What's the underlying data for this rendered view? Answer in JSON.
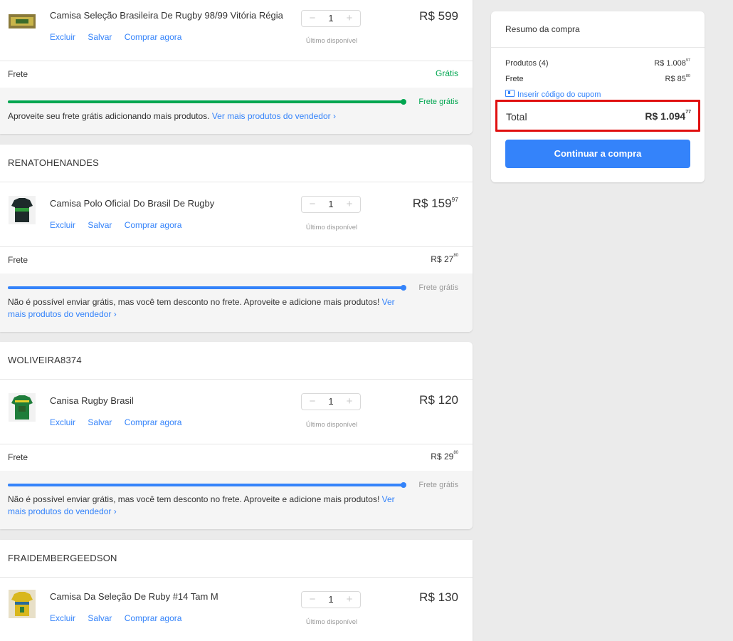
{
  "labels": {
    "excluir": "Excluir",
    "salvar": "Salvar",
    "comprar": "Comprar agora",
    "stock": "Último disponível",
    "frete": "Frete",
    "frete_gratis": "Frete grátis",
    "gratis": "Grátis",
    "minus": "−",
    "plus": "+"
  },
  "cards": [
    {
      "seller": "",
      "product": "Camisa Seleção Brasileira De Rugby 98/99 Vitória Régia",
      "quantity": "1",
      "price_int": "R$ 599",
      "price_cents": "",
      "shipping_price_int": "",
      "shipping_price_cents": "",
      "shipping_free_text": "Grátis",
      "progress": 1.0,
      "progress_color": "#00a650",
      "promo_text": "Aproveite seu frete grátis adicionando mais produtos.",
      "promo_link": "Ver mais produtos do vendedor ›"
    },
    {
      "seller": "RENATOHENANDES",
      "product": "Camisa Polo Oficial Do Brasil De Rugby",
      "quantity": "1",
      "price_int": "R$ 159",
      "price_cents": "97",
      "shipping_price_int": "R$ 27",
      "shipping_price_cents": "80",
      "progress": 1.0,
      "progress_color": "#3483fa",
      "promo_text": "Não é possível enviar grátis, mas você tem desconto no frete. Aproveite e adicione mais produtos!",
      "promo_link": "Ver mais produtos do vendedor ›"
    },
    {
      "seller": "WOLIVEIRA8374",
      "product": "Canisa Rugby Brasil",
      "quantity": "1",
      "price_int": "R$ 120",
      "price_cents": "",
      "shipping_price_int": "R$ 29",
      "shipping_price_cents": "80",
      "progress": 1.0,
      "progress_color": "#3483fa",
      "promo_text": "Não é possível enviar grátis, mas você tem desconto no frete. Aproveite e adicione mais produtos!",
      "promo_link": "Ver mais produtos do vendedor ›"
    },
    {
      "seller": "FRAIDEMBERGEEDSON",
      "product": "Camisa Da Seleção De Ruby #14 Tam M",
      "quantity": "1",
      "price_int": "R$ 130",
      "price_cents": ""
    }
  ],
  "summary": {
    "title": "Resumo da compra",
    "products_label": "Produtos (4)",
    "products_int": "R$ 1.008",
    "products_cents": "97",
    "shipping_label": "Frete",
    "shipping_int": "R$ 85",
    "shipping_cents": "80",
    "coupon_label": "Inserir código do cupom",
    "total_label": "Total",
    "total_int": "R$ 1.094",
    "total_cents": "77",
    "continue_label": "Continuar a compra"
  },
  "colors": {
    "accent": "#3483fa",
    "free_green": "#00a650",
    "highlight_red": "#e01010"
  }
}
